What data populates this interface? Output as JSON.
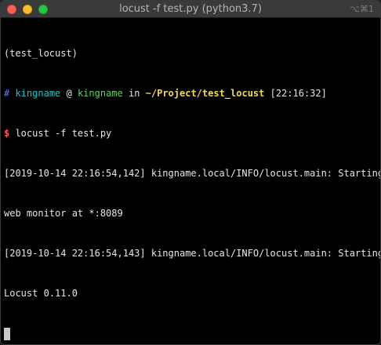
{
  "window": {
    "title": "locust -f test.py (python3.7)",
    "shortcut": "⌥⌘1"
  },
  "terminal": {
    "env_line": "(test_locust)",
    "prompt": {
      "hash": "#",
      "user": "kingname",
      "at": " @ ",
      "host": "kingname",
      "in": " in ",
      "path": "~/Project/test_locust",
      "time": " [22:16:32]"
    },
    "command_prompt": "$",
    "command": " locust -f test.py",
    "output": [
      "[2019-10-14 22:16:54,142] kingname.local/INFO/locust.main: Starting",
      "web monitor at *:8089",
      "[2019-10-14 22:16:54,143] kingname.local/INFO/locust.main: Starting",
      "Locust 0.11.0"
    ]
  },
  "colors": {
    "close": "#ff5f57",
    "minimize": "#febc2e",
    "maximize": "#28c840",
    "prompt_hash": "#6a7cf2",
    "user": "#23c4c4",
    "host": "#5fd35f",
    "path": "#f1d94c",
    "dollar": "#ff5a5a"
  }
}
